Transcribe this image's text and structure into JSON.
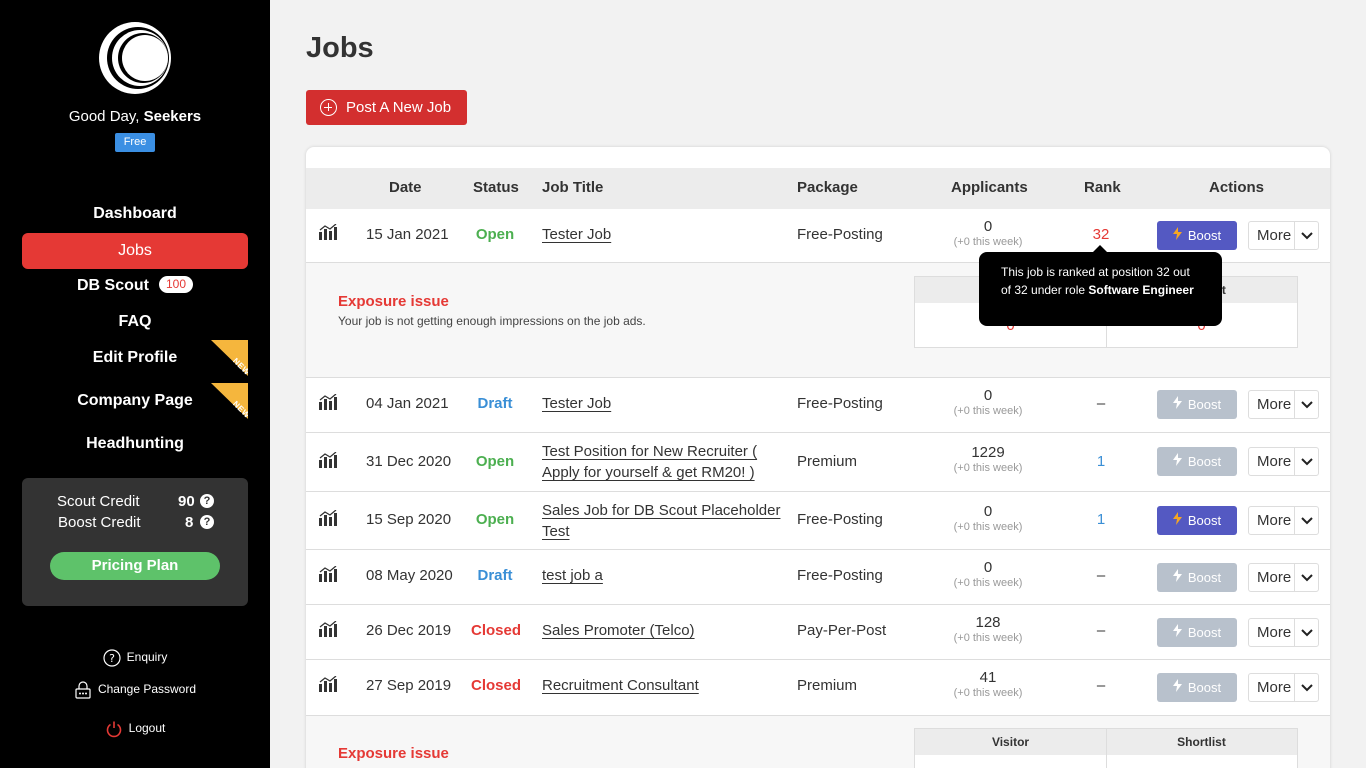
{
  "sidebar": {
    "greeting_prefix": "Good Day,",
    "username": "Seekers",
    "plan_badge": "Free",
    "nav": [
      {
        "label": "Dashboard"
      },
      {
        "label": "Jobs"
      },
      {
        "label": "DB Scout",
        "badge": "100"
      },
      {
        "label": "FAQ"
      },
      {
        "label": "Edit Profile",
        "ribbon": "NEW"
      },
      {
        "label": "Company Page",
        "ribbon": "NEW"
      },
      {
        "label": "Headhunting"
      }
    ],
    "credits": {
      "scout_label": "Scout Credit",
      "scout_value": "90",
      "boost_label": "Boost Credit",
      "boost_value": "8",
      "pricing_label": "Pricing Plan"
    },
    "links": {
      "enquiry": "Enquiry",
      "change_password": "Change Password",
      "logout": "Logout"
    }
  },
  "main": {
    "title": "Jobs",
    "post_button": "Post A New Job",
    "columns": [
      "Date",
      "Status",
      "Job Title",
      "Package",
      "Applicants",
      "Rank",
      "Actions"
    ],
    "boost_label": "Boost",
    "more_label": "More",
    "jobs": [
      {
        "date": "15 Jan 2021",
        "status": "Open",
        "title": "Tester Job",
        "package": "Free-Posting",
        "applicants": "0",
        "weekly": "(+0 this week)",
        "rank": "32"
      },
      {
        "date": "04 Jan 2021",
        "status": "Draft",
        "title": "Tester Job",
        "package": "Free-Posting",
        "applicants": "0",
        "weekly": "(+0 this week)",
        "rank": "–"
      },
      {
        "date": "31 Dec 2020",
        "status": "Open",
        "title": "Test Position for New Recruiter ( Apply for yourself & get RM20! )",
        "package": "Premium",
        "applicants": "1229",
        "weekly": "(+0 this week)",
        "rank": "1"
      },
      {
        "date": "15 Sep 2020",
        "status": "Open",
        "title": "Sales Job for DB Scout Placeholder Test",
        "package": "Free-Posting",
        "applicants": "0",
        "weekly": "(+0 this week)",
        "rank": "1"
      },
      {
        "date": "08 May 2020",
        "status": "Draft",
        "title": "test job a",
        "package": "Free-Posting",
        "applicants": "0",
        "weekly": "(+0 this week)",
        "rank": "–"
      },
      {
        "date": "26 Dec 2019",
        "status": "Closed",
        "title": "Sales Promoter (Telco)",
        "package": "Pay-Per-Post",
        "applicants": "128",
        "weekly": "(+0 this week)",
        "rank": "–"
      },
      {
        "date": "27 Sep 2019",
        "status": "Closed",
        "title": "Recruitment Consultant",
        "package": "Premium",
        "applicants": "41",
        "weekly": "(+0 this week)",
        "rank": "–"
      }
    ],
    "issue": {
      "title": "Exposure issue",
      "description": "Your job is not getting enough impressions on the job ads.",
      "visitor_label": "Visitor",
      "shortlist_label": "Shortlist",
      "visitor_value": "0",
      "shortlist_value": "0"
    },
    "tooltip": {
      "text": "This job is ranked at position 32 out of 32 under role ",
      "role": "Software Engineer"
    }
  },
  "colors": {
    "accent_red": "#e53935",
    "open_green": "#4caf50",
    "draft_blue": "#3a8fd6",
    "boost_active": "#5459c2",
    "boost_disabled": "#b8c1cc"
  }
}
